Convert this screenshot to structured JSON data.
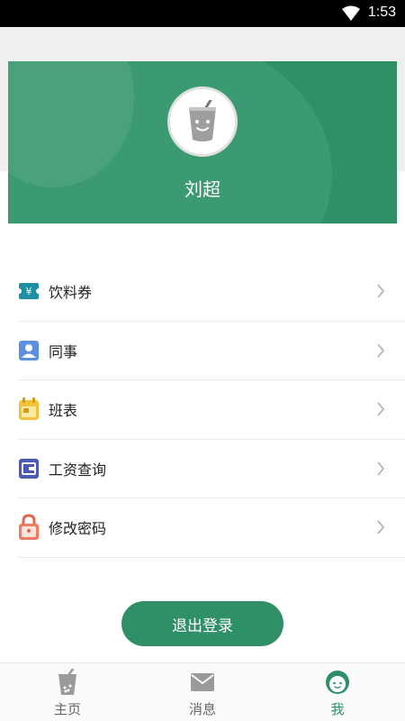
{
  "status_bar": {
    "time": "1:53"
  },
  "profile": {
    "name": "刘超"
  },
  "menu": [
    {
      "label": "饮料券",
      "icon": "voucher-icon"
    },
    {
      "label": "同事",
      "icon": "contact-icon"
    },
    {
      "label": "班表",
      "icon": "calendar-icon"
    },
    {
      "label": "工资查询",
      "icon": "wallet-icon"
    },
    {
      "label": "修改密码",
      "icon": "lock-icon"
    }
  ],
  "logout_label": "退出登录",
  "tabs": [
    {
      "label": "主页",
      "icon": "drink-cup-icon"
    },
    {
      "label": "消息",
      "icon": "mail-icon"
    },
    {
      "label": "我",
      "icon": "profile-face-icon",
      "active": true
    }
  ],
  "colors": {
    "accent": "#2f8f66",
    "active_tab": "#2f8f66"
  }
}
